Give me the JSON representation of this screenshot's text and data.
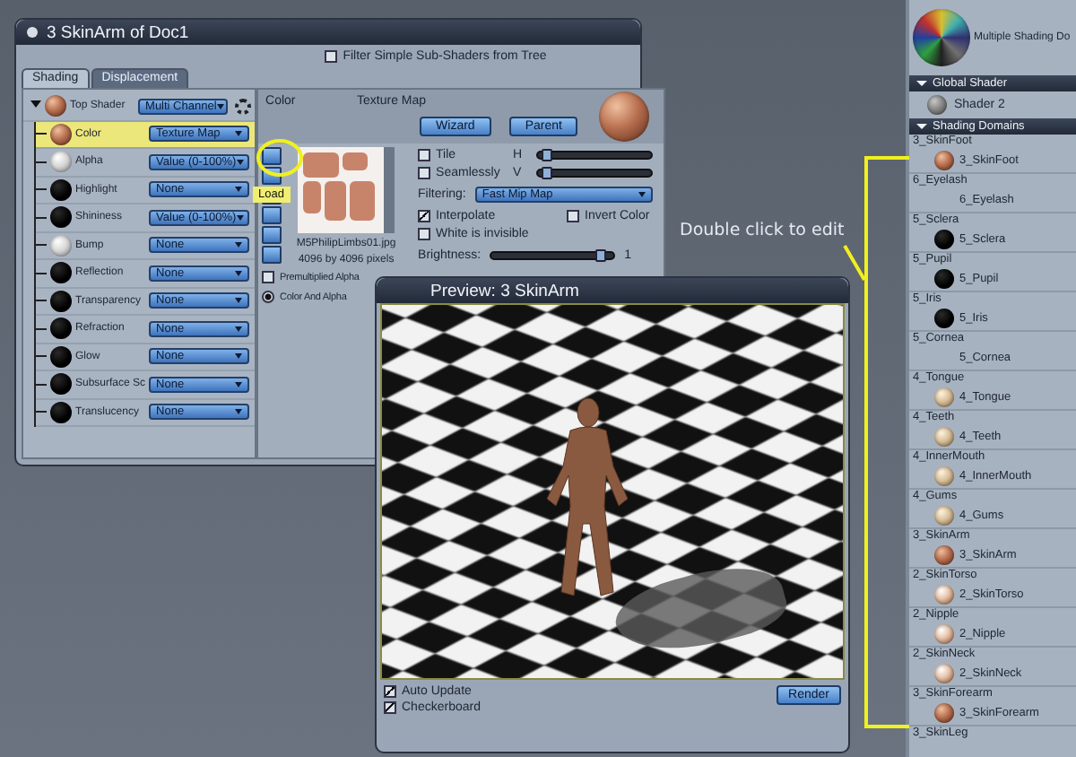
{
  "shader_window": {
    "title": "3  SkinArm of Doc1",
    "filter_checkbox": {
      "label": "Filter Simple Sub-Shaders from Tree",
      "checked": false
    },
    "tabs": [
      {
        "label": "Shading",
        "selected": true
      },
      {
        "label": "Displacement",
        "selected": false
      }
    ],
    "tree": {
      "label": "Top Shader",
      "kind": "skin",
      "value": "Multi Channel",
      "selected": false,
      "children": [
        {
          "label": "Color",
          "kind": "skin",
          "value": "Texture Map",
          "selected": true
        },
        {
          "label": "Alpha",
          "kind": "white",
          "value": "Value (0-100%)",
          "selected": false
        },
        {
          "label": "Highlight",
          "kind": "black",
          "value": "None",
          "selected": false
        },
        {
          "label": "Shininess",
          "kind": "black",
          "value": "Value (0-100%)",
          "selected": false
        },
        {
          "label": "Bump",
          "kind": "white",
          "value": "None",
          "selected": false
        },
        {
          "label": "Reflection",
          "kind": "black",
          "value": "None",
          "selected": false
        },
        {
          "label": "Transparency",
          "kind": "black",
          "value": "None",
          "selected": false
        },
        {
          "label": "Refraction",
          "kind": "black",
          "value": "None",
          "selected": false
        },
        {
          "label": "Glow",
          "kind": "black",
          "value": "None",
          "selected": false
        },
        {
          "label": "Subsurface Sc",
          "kind": "black",
          "value": "None",
          "selected": false
        },
        {
          "label": "Translucency",
          "kind": "black",
          "value": "None",
          "selected": false
        }
      ]
    },
    "editor": {
      "channel": "Color",
      "type": "Texture Map",
      "kind": "skin",
      "buttons": [
        "Wizard",
        "Parent"
      ],
      "tooltip": "Load",
      "file_name": "M5PhilipLimbs01.jpg",
      "dimensions": "4096 by 4096 pixels",
      "tile": {
        "label": "Tile",
        "checked": false
      },
      "seamlessly": {
        "label": "Seamlessly",
        "checked": false
      },
      "sliders": [
        {
          "label": "H",
          "level": 0.03
        },
        {
          "label": "V",
          "level": 0.03
        }
      ],
      "filtering": {
        "label": "Filtering:",
        "value": "Fast Mip Map"
      },
      "options": [
        {
          "label": "Interpolate",
          "checked": true
        },
        {
          "label": "Invert Color",
          "checked": false
        },
        {
          "label": "White is invisible",
          "checked": false
        }
      ],
      "brightness": {
        "label": "Brightness:",
        "level": 0.93,
        "reading": "1"
      },
      "premultiplied": {
        "label": "Premultiplied Alpha",
        "checked": false
      },
      "alpha_mode": [
        {
          "label": "Color And Alpha",
          "selected": true
        }
      ]
    }
  },
  "preview_window": {
    "title": "Preview: 3  SkinArm",
    "options": [
      {
        "label": "Auto Update",
        "checked": true
      },
      {
        "label": "Checkerboard",
        "checked": true
      }
    ],
    "button": "Render"
  },
  "annotation": {
    "text": "Double click to edit"
  },
  "domains_panel": {
    "shader": {
      "label": "Multiple Shading Do",
      "kind": "multi"
    },
    "global_shader": {
      "header": "Global Shader",
      "expanded": true,
      "shader": "Shader 2",
      "kind": "grey"
    },
    "shading_domains": {
      "header": "Shading Domains",
      "expanded": true,
      "domains": [
        {
          "name": "3_SkinFoot",
          "shader": "3_SkinFoot",
          "kind": "skin"
        },
        {
          "name": "6_Eyelash",
          "shader": "6_Eyelash",
          "kind": "none"
        },
        {
          "name": "5_Sclera",
          "shader": "5_Sclera",
          "kind": "black"
        },
        {
          "name": "5_Pupil",
          "shader": "5_Pupil",
          "kind": "black"
        },
        {
          "name": "5_Iris",
          "shader": "5_Iris",
          "kind": "black"
        },
        {
          "name": "5_Cornea",
          "shader": "5_Cornea",
          "kind": "none"
        },
        {
          "name": "4_Tongue",
          "shader": "4_Tongue",
          "kind": "beige"
        },
        {
          "name": "4_Teeth",
          "shader": "4_Teeth",
          "kind": "beige"
        },
        {
          "name": "4_InnerMouth",
          "shader": "4_InnerMouth",
          "kind": "beige"
        },
        {
          "name": "4_Gums",
          "shader": "4_Gums",
          "kind": "beige"
        },
        {
          "name": "3_SkinArm",
          "shader": "3_SkinArm",
          "kind": "skin"
        },
        {
          "name": "2_SkinTorso",
          "shader": "2_SkinTorso",
          "kind": "pale"
        },
        {
          "name": "2_Nipple",
          "shader": "2_Nipple",
          "kind": "pale"
        },
        {
          "name": "2_SkinNeck",
          "shader": "2_SkinNeck",
          "kind": "pale"
        },
        {
          "name": "3_SkinForearm",
          "shader": "3_SkinForearm",
          "kind": "skin"
        },
        {
          "name": "3_SkinLeg"
        }
      ]
    }
  }
}
